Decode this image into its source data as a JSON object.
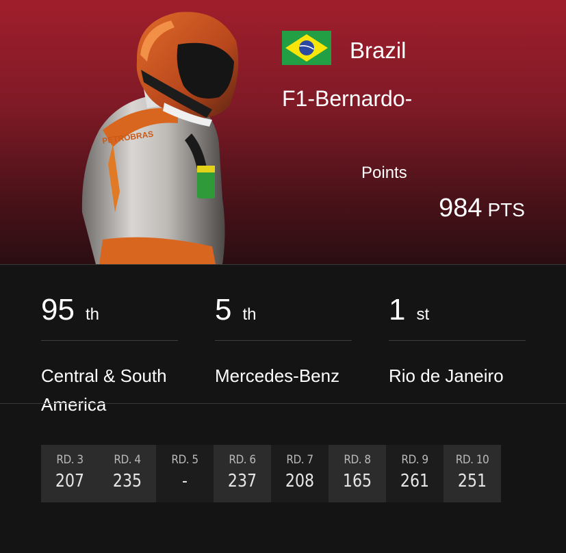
{
  "profile": {
    "country": "Brazil",
    "driver_name": "F1-Bernardo-",
    "points_label": "Points",
    "points_value": "984",
    "points_unit": "PTS",
    "suit_text": "PETROBRAS"
  },
  "stats": [
    {
      "rank": "95",
      "suffix": "th",
      "label": "Central & South America"
    },
    {
      "rank": "5",
      "suffix": "th",
      "label": "Mercedes-Benz"
    },
    {
      "rank": "1",
      "suffix": "st",
      "label": "Rio de Janeiro"
    }
  ],
  "rounds": [
    {
      "label": "RD. 3",
      "score": "207"
    },
    {
      "label": "RD. 4",
      "score": "235"
    },
    {
      "label": "RD. 5",
      "score": "-"
    },
    {
      "label": "RD. 6",
      "score": "237"
    },
    {
      "label": "RD. 7",
      "score": "208"
    },
    {
      "label": "RD. 8",
      "score": "165"
    },
    {
      "label": "RD. 9",
      "score": "261"
    },
    {
      "label": "RD. 10",
      "score": "251"
    }
  ],
  "colors": {
    "hero_top": "#a01e2c",
    "hero_bottom": "#2a0e12",
    "background": "#141414",
    "flag_green": "#229e45",
    "flag_yellow": "#f8e509",
    "flag_blue": "#2b49a3"
  },
  "icons": {
    "flag": "brazil-flag-icon",
    "driver": "driver-figure"
  }
}
